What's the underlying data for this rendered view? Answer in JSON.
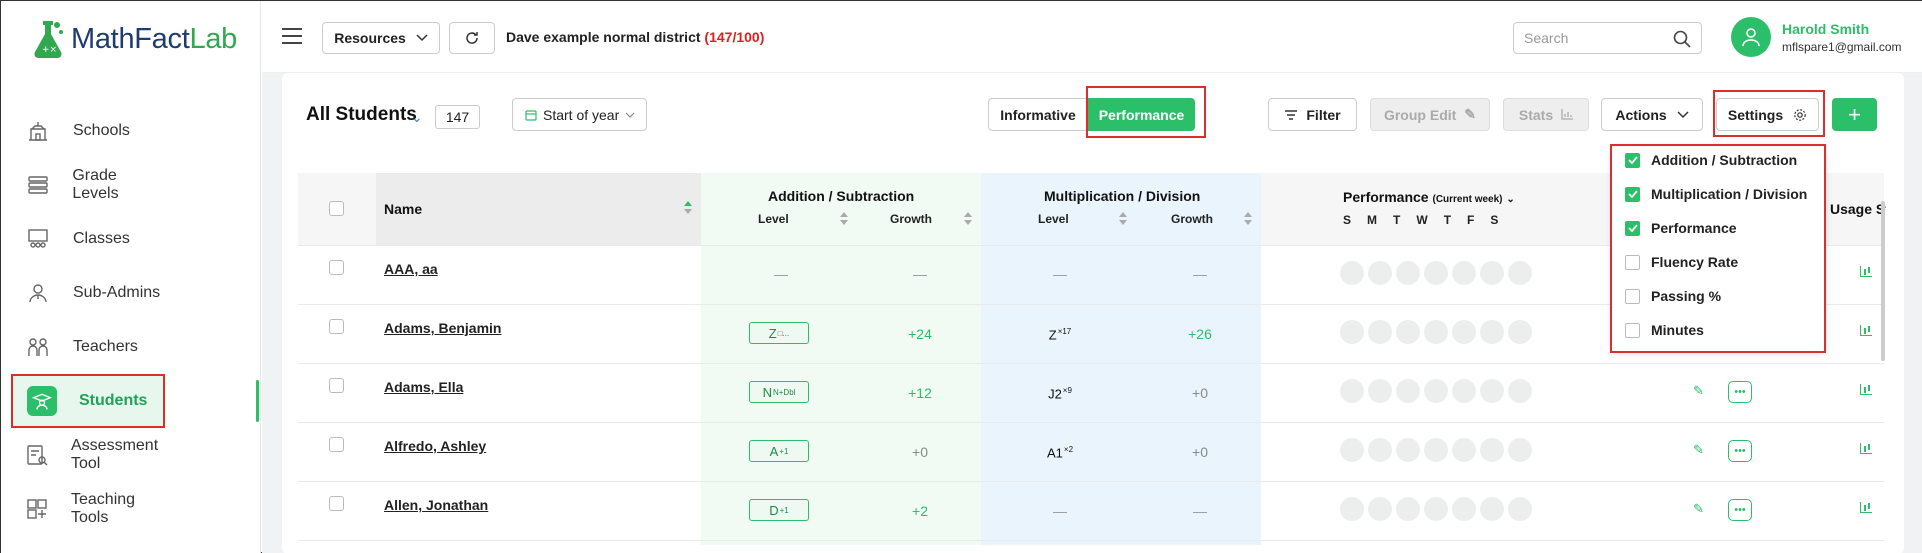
{
  "brand": {
    "part1": "MathFact",
    "part2": "Lab"
  },
  "sidebar": {
    "items": [
      {
        "label": "Schools",
        "icon": "school-icon"
      },
      {
        "label": "Grade Levels",
        "icon": "layers-icon"
      },
      {
        "label": "Classes",
        "icon": "classroom-icon"
      },
      {
        "label": "Sub-Admins",
        "icon": "admin-icon"
      },
      {
        "label": "Teachers",
        "icon": "teachers-icon"
      },
      {
        "label": "Students",
        "icon": "student-icon",
        "active": true
      },
      {
        "label": "Assessment Tool",
        "icon": "assessment-icon"
      },
      {
        "label": "Teaching Tools",
        "icon": "teaching-tools-icon"
      }
    ]
  },
  "topbar": {
    "resources_label": "Resources",
    "district_text": "Dave example normal district",
    "district_count": "(147/100)",
    "search_placeholder": "Search",
    "user_name": "Harold Smith",
    "user_email": "mflspare1@gmail.com"
  },
  "toolbar": {
    "title": "All Students",
    "count": "147",
    "period": "Start of year",
    "informative_label": "Informative",
    "performance_label": "Performance",
    "filter_label": "Filter",
    "group_edit_label": "Group Edit",
    "stats_label": "Stats",
    "actions_label": "Actions",
    "settings_label": "Settings",
    "add_label": "+"
  },
  "table": {
    "name_header": "Name",
    "add_sub_header": "Addition / Subtraction",
    "mul_div_header": "Multiplication / Division",
    "level_label": "Level",
    "growth_label": "Growth",
    "performance_header": "Performance",
    "performance_sub": "(Current week)",
    "days": [
      "S",
      "M",
      "T",
      "W",
      "T",
      "F",
      "S"
    ],
    "usage_header": "Usage St",
    "rows": [
      {
        "name": "AAA, aa",
        "add_level": "—",
        "add_level_sup": "",
        "add_growth": "—",
        "mul_level": "—",
        "mul_level_sup": "",
        "mul_growth": "—"
      },
      {
        "name": "Adams, Benjamin",
        "add_level": "Z",
        "add_level_sup": "□...",
        "add_growth": "+24",
        "mul_level": "Z",
        "mul_level_sup": "×17",
        "mul_growth": "+26"
      },
      {
        "name": "Adams, Ella",
        "add_level": "N",
        "add_level_sup": "N+Dbl",
        "add_growth": "+12",
        "mul_level": "J2",
        "mul_level_sup": "×9",
        "mul_growth": "+0"
      },
      {
        "name": "Alfredo, Ashley",
        "add_level": "A",
        "add_level_sup": "+1",
        "add_growth": "+0",
        "mul_level": "A1",
        "mul_level_sup": "×2",
        "mul_growth": "+0"
      },
      {
        "name": "Allen, Jonathan",
        "add_level": "D",
        "add_level_sup": "+1",
        "add_growth": "+2",
        "mul_level": "—",
        "mul_level_sup": "",
        "mul_growth": "—"
      }
    ]
  },
  "settings_menu": {
    "options": [
      {
        "label": "Addition / Subtraction",
        "checked": true
      },
      {
        "label": "Multiplication / Division",
        "checked": true
      },
      {
        "label": "Performance",
        "checked": true
      },
      {
        "label": "Fluency Rate",
        "checked": false
      },
      {
        "label": "Passing %",
        "checked": false
      },
      {
        "label": "Minutes",
        "checked": false
      }
    ]
  },
  "colors": {
    "accent": "#2bbf6a",
    "brand_dark": "#1f3c6e",
    "highlight_red": "#d9302c"
  }
}
